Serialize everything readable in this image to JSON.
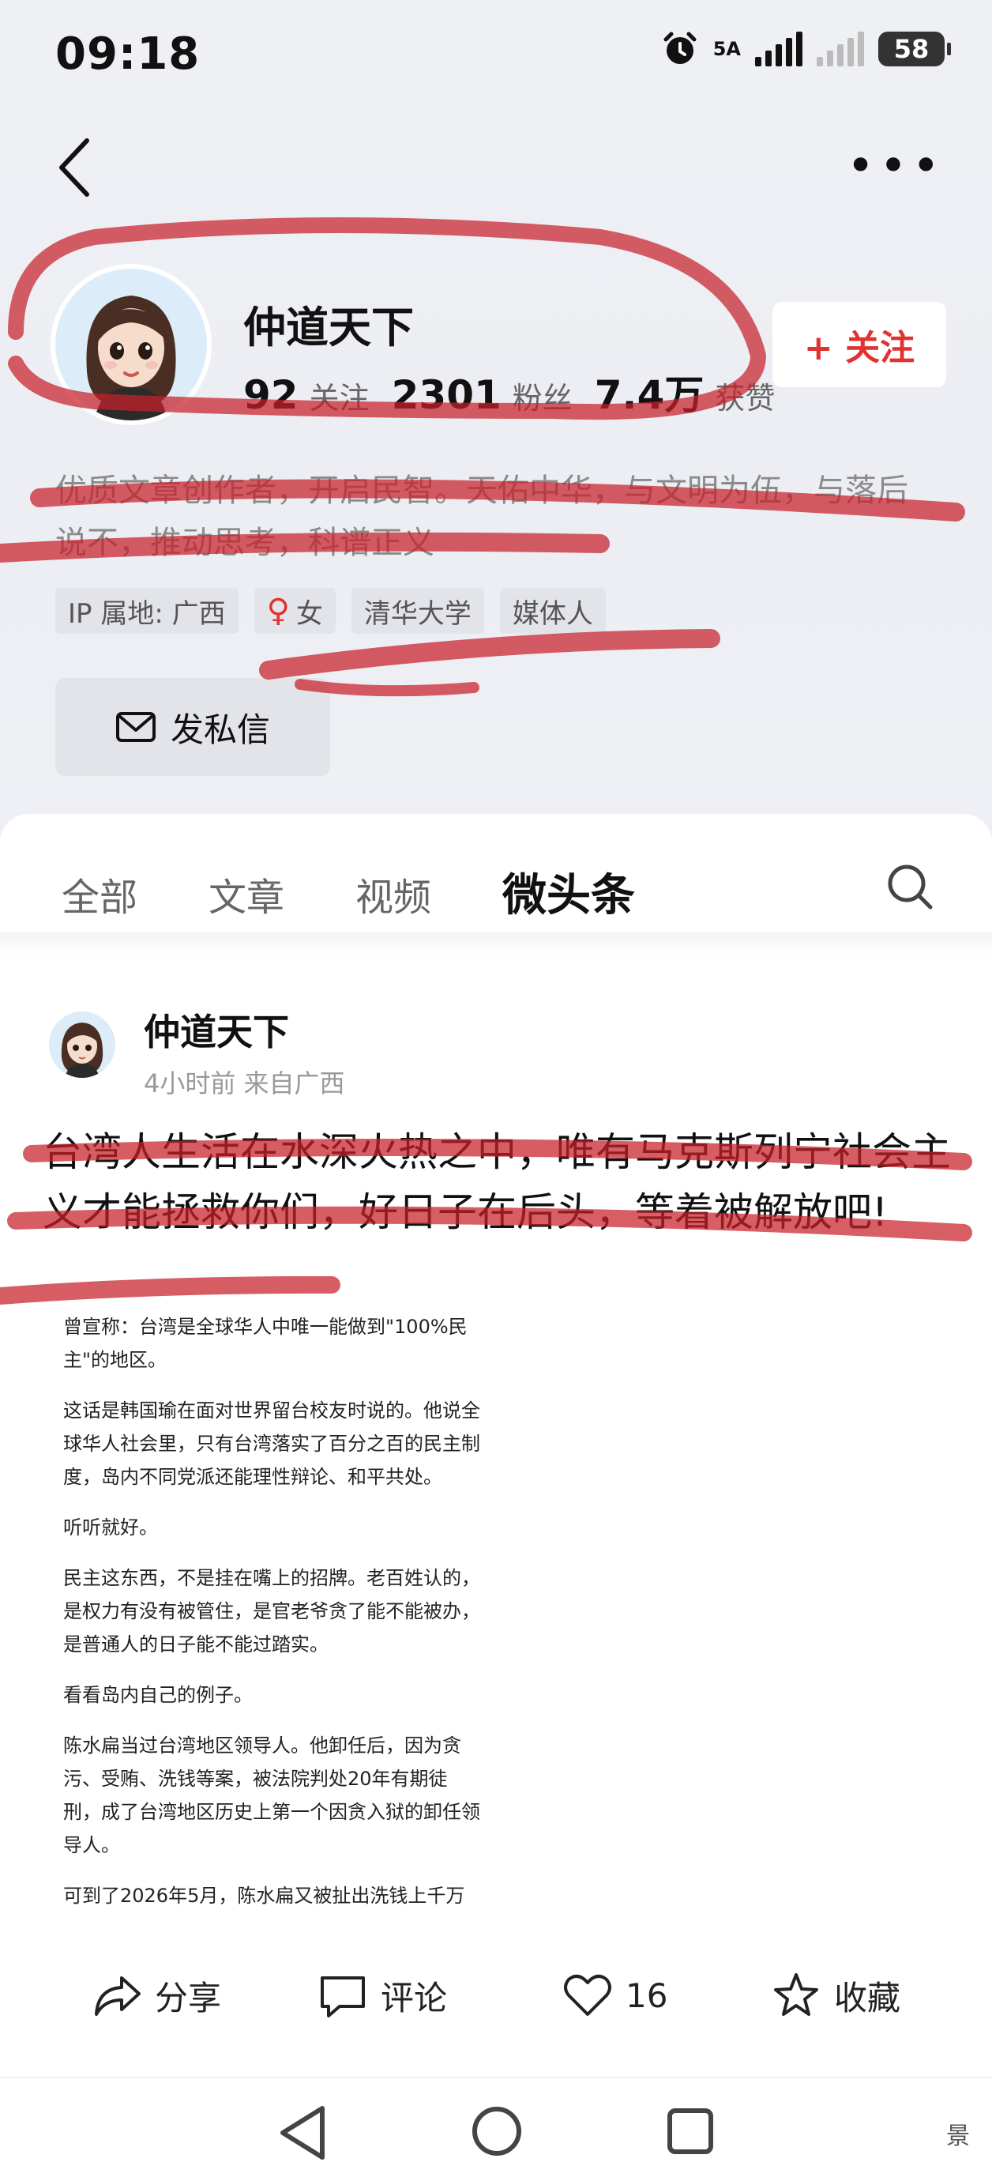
{
  "status_bar": {
    "time": "09:18",
    "network_label": "5A",
    "battery": "58"
  },
  "profile": {
    "name": "仲道天下",
    "following_count": "92",
    "following_label": "关注",
    "followers_count": "2301",
    "followers_label": "粉丝",
    "likes_count": "7.4万",
    "likes_label": "获赞",
    "follow_button": "+ 关注",
    "bio": "优质文章创作者，开启民智。天佑中华，与文明为伍，与落后说不，推动思考，科谱正义",
    "tags": {
      "ip": "IP 属地: 广西",
      "gender": "女",
      "school": "清华大学",
      "role": "媒体人"
    },
    "message_button": "发私信"
  },
  "tabs": [
    "全部",
    "文章",
    "视频",
    "微头条"
  ],
  "active_tab": "微头条",
  "post": {
    "author": "仲道天下",
    "meta": "4小时前 来自广西",
    "text": "台湾人生活在水深火热之中，唯有马克斯列宁社会主义才能拯救你们，好日子在后头，等着被解放吧!",
    "article_paragraphs": [
      "曾宣称：台湾是全球华人中唯一能做到\"100%民主\"的地区。",
      "这话是韩国瑜在面对世界留台校友时说的。他说全球华人社会里，只有台湾落实了百分之百的民主制度，岛内不同党派还能理性辩论、和平共处。",
      "听听就好。",
      "民主这东西，不是挂在嘴上的招牌。老百姓认的，是权力有没有被管住，是官老爷贪了能不能被办，是普通人的日子能不能过踏实。",
      "看看岛内自己的例子。",
      "陈水扁当过台湾地区领导人。他卸任后，因为贪污、受贿、洗钱等案，被法院判处20年有期徒刑，成了台湾地区历史上第一个因贪入狱的卸任领导人。",
      "可到了2026年5月，陈水扁又被扯出洗钱上千万"
    ],
    "actions": {
      "share": "分享",
      "comment": "评论",
      "like_count": "16",
      "favorite": "收藏"
    }
  },
  "nav": {
    "watermark": "景"
  },
  "colors": {
    "accent": "#e0322f",
    "annotation": "#c8202a"
  }
}
